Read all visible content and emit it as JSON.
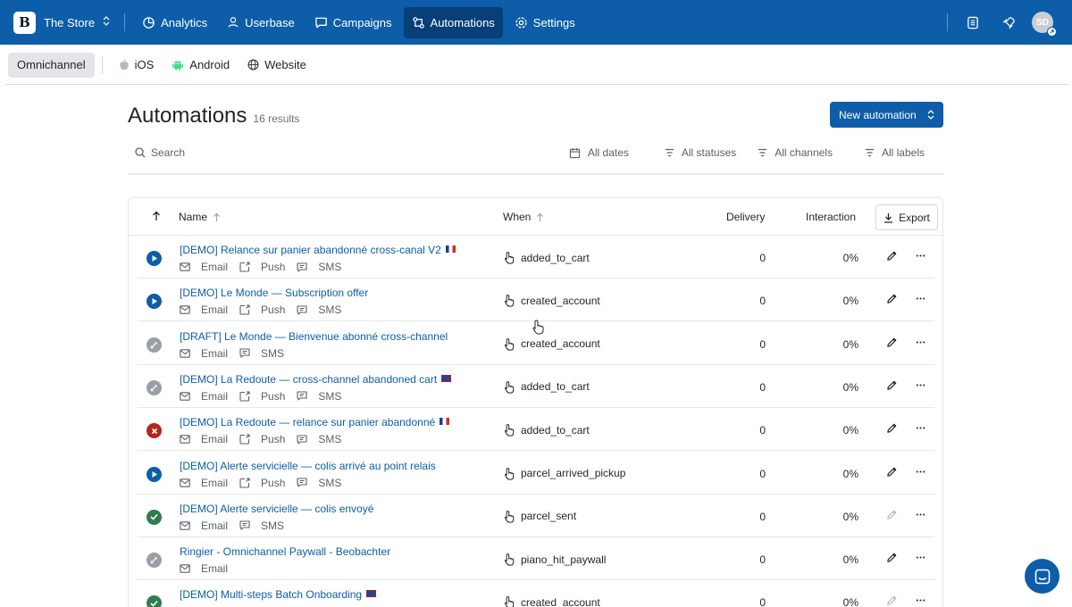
{
  "brand": {
    "name": "The Store",
    "logo_letter": "B"
  },
  "nav": [
    {
      "label": "Analytics",
      "icon": "chart-pie-icon",
      "active": false
    },
    {
      "label": "Userbase",
      "icon": "user-icon",
      "active": false
    },
    {
      "label": "Campaigns",
      "icon": "message-square-icon",
      "active": false
    },
    {
      "label": "Automations",
      "icon": "workflow-icon",
      "active": true
    },
    {
      "label": "Settings",
      "icon": "gear-icon",
      "active": false
    }
  ],
  "user": {
    "initials": "SD"
  },
  "platforms": [
    {
      "label": "Omnichannel",
      "active": true
    },
    {
      "label": "iOS",
      "icon": "apple-icon"
    },
    {
      "label": "Android",
      "icon": "android-icon"
    },
    {
      "label": "Website",
      "icon": "globe-icon"
    }
  ],
  "page": {
    "title": "Automations",
    "count": "16 results",
    "new_button": "New automation"
  },
  "filters": {
    "search_placeholder": "Search",
    "dates": "All dates",
    "statuses": "All statuses",
    "channels": "All channels",
    "labels": "All labels"
  },
  "table": {
    "headers": {
      "name": "Name",
      "when": "When",
      "delivery": "Delivery",
      "interaction": "Interaction",
      "export": "Export"
    },
    "channel_labels": {
      "email": "Email",
      "push": "Push",
      "sms": "SMS"
    },
    "rows": [
      {
        "status": "running",
        "name": "[DEMO] Relance sur panier abandonné cross-canal V2",
        "flag": "fr",
        "channels": [
          "Email",
          "Push",
          "SMS"
        ],
        "when": "added_to_cart",
        "delivery": "0",
        "interaction": "0%"
      },
      {
        "status": "running",
        "name": "[DEMO] Le Monde — Subscription offer",
        "flag": "",
        "channels": [
          "Email",
          "Push",
          "SMS"
        ],
        "when": "created_account",
        "delivery": "0",
        "interaction": "0%"
      },
      {
        "status": "draft",
        "name": "[DRAFT] Le Monde — Bienvenue abonné cross-channel",
        "flag": "",
        "channels": [
          "Email",
          "SMS"
        ],
        "when": "created_account",
        "delivery": "0",
        "interaction": "0%"
      },
      {
        "status": "draft",
        "name": "[DEMO] La Redoute — cross-channel abandoned cart",
        "flag": "uk",
        "channels": [
          "Email",
          "Push",
          "SMS"
        ],
        "when": "added_to_cart",
        "delivery": "0",
        "interaction": "0%"
      },
      {
        "status": "error",
        "name": "[DEMO] La Redoute — relance sur panier abandonné",
        "flag": "fr",
        "channels": [
          "Email",
          "Push",
          "SMS"
        ],
        "when": "added_to_cart",
        "delivery": "0",
        "interaction": "0%"
      },
      {
        "status": "running",
        "name": "[DEMO] Alerte servicielle — colis arrivé au point relais",
        "flag": "",
        "channels": [
          "Email",
          "Push",
          "SMS"
        ],
        "when": "parcel_arrived_pickup",
        "delivery": "0",
        "interaction": "0%"
      },
      {
        "status": "done",
        "name": "[DEMO] Alerte servicielle — colis envoyé",
        "flag": "",
        "channels": [
          "Email",
          "SMS"
        ],
        "when": "parcel_sent",
        "delivery": "0",
        "interaction": "0%"
      },
      {
        "status": "draft",
        "name": "Ringier - Omnichannel Paywall - Beobachter",
        "flag": "",
        "channels": [
          "Email"
        ],
        "when": "piano_hit_paywall",
        "delivery": "0",
        "interaction": "0%"
      },
      {
        "status": "done",
        "name": "[DEMO] Multi-steps Batch Onboarding",
        "flag": "uk",
        "channels": [],
        "when": "created_account",
        "delivery": "0",
        "interaction": "0%"
      }
    ]
  },
  "colors": {
    "brand_blue": "#0d5da8",
    "nav_active": "#073f78",
    "running": "#0d5da8",
    "draft": "#9a9fa6",
    "error": "#b3261e",
    "done": "#2e7d4f"
  }
}
